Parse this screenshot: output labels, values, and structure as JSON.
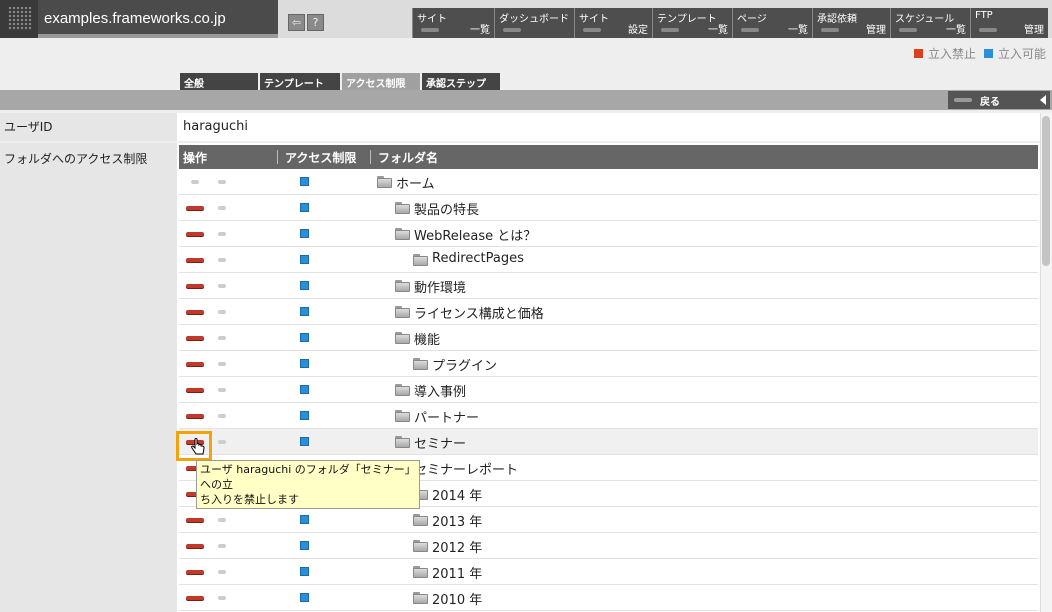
{
  "header": {
    "site_title": "examples.frameworks.co.jp",
    "nav": [
      {
        "top": "サイト",
        "bottom": "一覧"
      },
      {
        "top": "ダッシュボード",
        "bottom": ""
      },
      {
        "top": "サイト",
        "bottom": "設定"
      },
      {
        "top": "テンプレート",
        "bottom": "一覧"
      },
      {
        "top": "ページ",
        "bottom": "一覧"
      },
      {
        "top": "承認依頼",
        "bottom": "管理"
      },
      {
        "top": "スケジュール",
        "bottom": "一覧"
      },
      {
        "top": "FTP",
        "bottom": "管理"
      }
    ],
    "help_glyph": "?"
  },
  "legend": {
    "deny": "立入禁止",
    "allow": "立入可能",
    "deny_color": "#d9411e",
    "allow_color": "#2b8fd8"
  },
  "tabs": [
    "全般",
    "テンプレート",
    "アクセス制限",
    "承認ステップ"
  ],
  "active_tab": 2,
  "back_label": "戻る",
  "form": {
    "user_label": "ユーザID",
    "user_value": "haraguchi",
    "folder_label": "フォルダへのアクセス制限"
  },
  "table": {
    "col_ops": "操作",
    "col_access": "アクセス制限",
    "col_folder": "フォルダ名",
    "rows": [
      {
        "name": "ホーム",
        "depth": 0,
        "deny": false
      },
      {
        "name": "製品の特長",
        "depth": 1,
        "deny": true
      },
      {
        "name": "WebRelease とは？",
        "depth": 1,
        "deny": true
      },
      {
        "name": "RedirectPages",
        "depth": 2,
        "deny": true
      },
      {
        "name": "動作環境",
        "depth": 1,
        "deny": true
      },
      {
        "name": "ライセンス構成と価格",
        "depth": 1,
        "deny": true
      },
      {
        "name": "機能",
        "depth": 1,
        "deny": true
      },
      {
        "name": "プラグイン",
        "depth": 2,
        "deny": true
      },
      {
        "name": "導入事例",
        "depth": 1,
        "deny": true
      },
      {
        "name": "パートナー",
        "depth": 1,
        "deny": true
      },
      {
        "name": "セミナー",
        "depth": 1,
        "deny": true,
        "hovered": true
      },
      {
        "name": "セミナーレポート",
        "depth": 1,
        "deny": true
      },
      {
        "name": "2014 年",
        "depth": 2,
        "deny": true
      },
      {
        "name": "2013 年",
        "depth": 2,
        "deny": true
      },
      {
        "name": "2012 年",
        "depth": 2,
        "deny": true
      },
      {
        "name": "2011 年",
        "depth": 2,
        "deny": true
      },
      {
        "name": "2010 年",
        "depth": 2,
        "deny": true
      }
    ]
  },
  "tooltip": {
    "line1": "ユーザ haraguchi のフォルダ「セミナー」への立",
    "line2": "ち入りを禁止します"
  }
}
